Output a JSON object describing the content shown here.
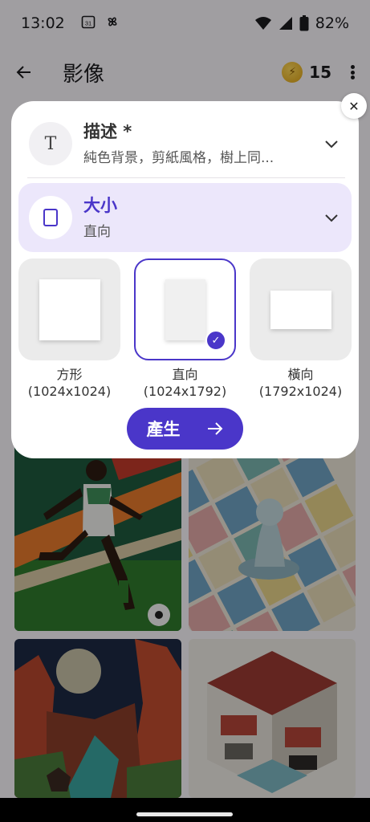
{
  "status_bar": {
    "time": "13:02",
    "calendar_icon": "31",
    "battery": "82%"
  },
  "app_bar": {
    "title": "影像",
    "credits": "15"
  },
  "dialog": {
    "description": {
      "title": "描述 *",
      "value": "純色背景，剪紙風格，樹上同..."
    },
    "size": {
      "title": "大小",
      "value": "直向"
    },
    "options": [
      {
        "label": "方形",
        "dims": "(1024x1024)",
        "selected": false
      },
      {
        "label": "直向",
        "dims": "(1024x1792)",
        "selected": true
      },
      {
        "label": "橫向",
        "dims": "(1792x1024)",
        "selected": false
      }
    ],
    "generate_label": "產生"
  },
  "colors": {
    "accent": "#4a36c9",
    "accent_light": "#ece7fb",
    "scrim": "#5c5c5c"
  },
  "icons": {
    "back": "arrow-left-icon",
    "more": "more-vertical-icon",
    "close": "close-icon",
    "chevron": "chevron-down-icon",
    "check": "check-icon",
    "arrow": "arrow-right-icon"
  }
}
